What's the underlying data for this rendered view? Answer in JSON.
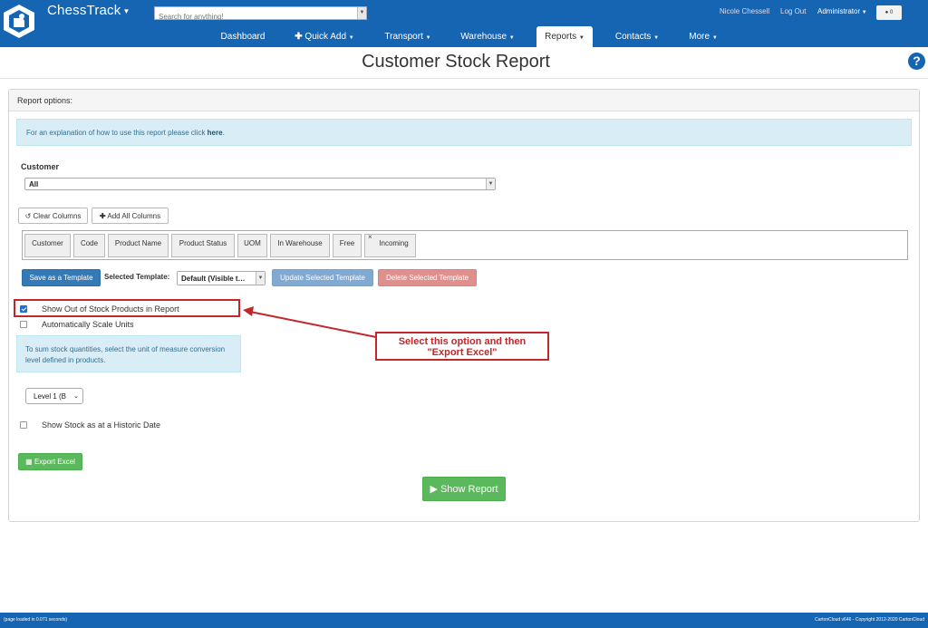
{
  "app": {
    "brand": "ChessTrack",
    "search_placeholder": "Search for anything!",
    "user_name": "Nicole Chessell",
    "logout_label": "Log Out",
    "role_label": "Administrator",
    "notification_count": "0"
  },
  "nav": {
    "items": [
      {
        "label": "Dashboard"
      },
      {
        "label": "Quick Add"
      },
      {
        "label": "Transport"
      },
      {
        "label": "Warehouse"
      },
      {
        "label": "Reports"
      },
      {
        "label": "Contacts"
      },
      {
        "label": "More"
      }
    ],
    "active": "Reports"
  },
  "page": {
    "title": "Customer Stock Report",
    "help_symbol": "?"
  },
  "panel": {
    "header": "Report options:",
    "info_text": "For an explanation of how to use this report please click ",
    "info_link": "here",
    "info_suffix": ".",
    "customer_label": "Customer",
    "customer_value": "All",
    "clear_columns_label": "Clear Columns",
    "add_all_columns_label": "Add All Columns",
    "columns": [
      "Customer",
      "Code",
      "Product Name",
      "Product Status",
      "UOM",
      "In Warehouse",
      "Free",
      "Incoming"
    ],
    "save_template_label": "Save as a Template",
    "selected_template_label": "Selected Template:",
    "selected_template_value": "Default (Visible t…",
    "update_template_label": "Update Selected Template",
    "delete_template_label": "Delete Selected Template",
    "show_out_of_stock_label": "Show Out of Stock Products in Report",
    "show_out_of_stock_checked": true,
    "auto_scale_label": "Automatically Scale Units",
    "auto_scale_checked": false,
    "scale_info_line1": "To sum stock quantities, select the unit of measure conversion",
    "scale_info_line2": "level defined in products.",
    "level_value": "Level 1 (B",
    "historic_label": "Show Stock as at a Historic Date",
    "historic_checked": false,
    "export_excel_label": "Export Excel",
    "show_report_label": "Show Report"
  },
  "annotation": {
    "line1": "Select this option and then",
    "line2": "\"Export Excel\"",
    "color": "#c0282c"
  },
  "footer": {
    "left": "(page loaded in 0.071 seconds)",
    "right": "CartonCloud v646 - Copyright 2012-2020 CartonCloud"
  },
  "colors": {
    "nav_blue": "#1565b3",
    "primary": "#337ab7",
    "success": "#5cb85c",
    "info_bg": "#d9edf7"
  }
}
